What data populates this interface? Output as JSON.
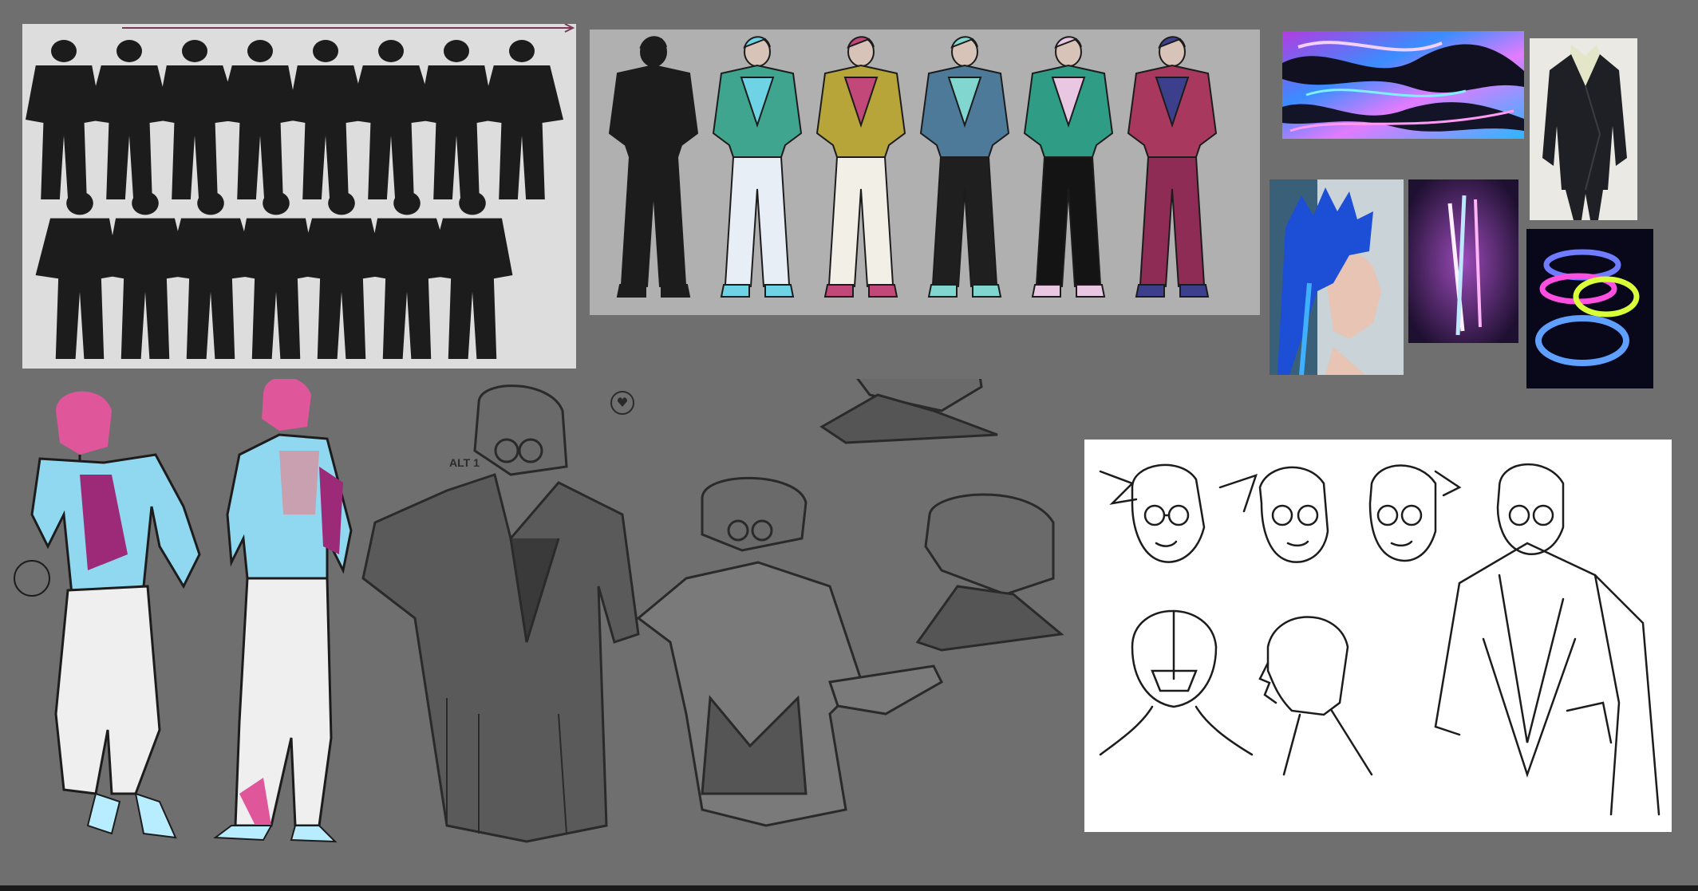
{
  "canvas": {
    "background": "#6f6f6f"
  },
  "silhouettes": {
    "rows": 2,
    "row1_count": 8,
    "row2_count": 7,
    "fill": "#1c1c1c",
    "background": "#dddddd",
    "arrow_color": "#7a3a55"
  },
  "colorways": {
    "background": "#b0b0b0",
    "figures": [
      {
        "top": "#1c1c1c",
        "bottom": "#1c1c1c",
        "accent": "#1c1c1c"
      },
      {
        "top": "#3fa58e",
        "bottom": "#e8eef5",
        "accent": "#6fd3e6"
      },
      {
        "top": "#b7a53a",
        "bottom": "#f2f0e6",
        "accent": "#c2487a"
      },
      {
        "top": "#4e7a9a",
        "bottom": "#1f1f1f",
        "accent": "#82d6d0"
      },
      {
        "top": "#2f9c86",
        "bottom": "#141414",
        "accent": "#e9c6e2"
      },
      {
        "top": "#a8385e",
        "bottom": "#8e2c55",
        "accent": "#3c3f8c"
      }
    ]
  },
  "reference_images": [
    {
      "name": "marble-swirl",
      "colors": [
        "#c03de0",
        "#2aa0ff",
        "#0f0f1f",
        "#e8b6ff"
      ]
    },
    {
      "name": "black-suit",
      "colors": [
        "#1f2126",
        "#e3e6cf"
      ]
    },
    {
      "name": "blue-mohawk",
      "colors": [
        "#1a4fd8",
        "#e9c7b8"
      ]
    },
    {
      "name": "neon-tubes",
      "colors": [
        "#ff9ef5",
        "#9bd8ff",
        "#2a1838"
      ]
    },
    {
      "name": "glow-rings",
      "colors": [
        "#6c7bff",
        "#d8ff3a",
        "#ff4de0"
      ]
    }
  ],
  "sketches": {
    "alt_label": "ALT 1",
    "colors": {
      "pink": "#e0569b",
      "cyan": "#8fd8f0",
      "magenta": "#9c2a78",
      "white": "#efefef",
      "ink": "#1c1c1c",
      "graphite": "#3a3a3a"
    }
  }
}
